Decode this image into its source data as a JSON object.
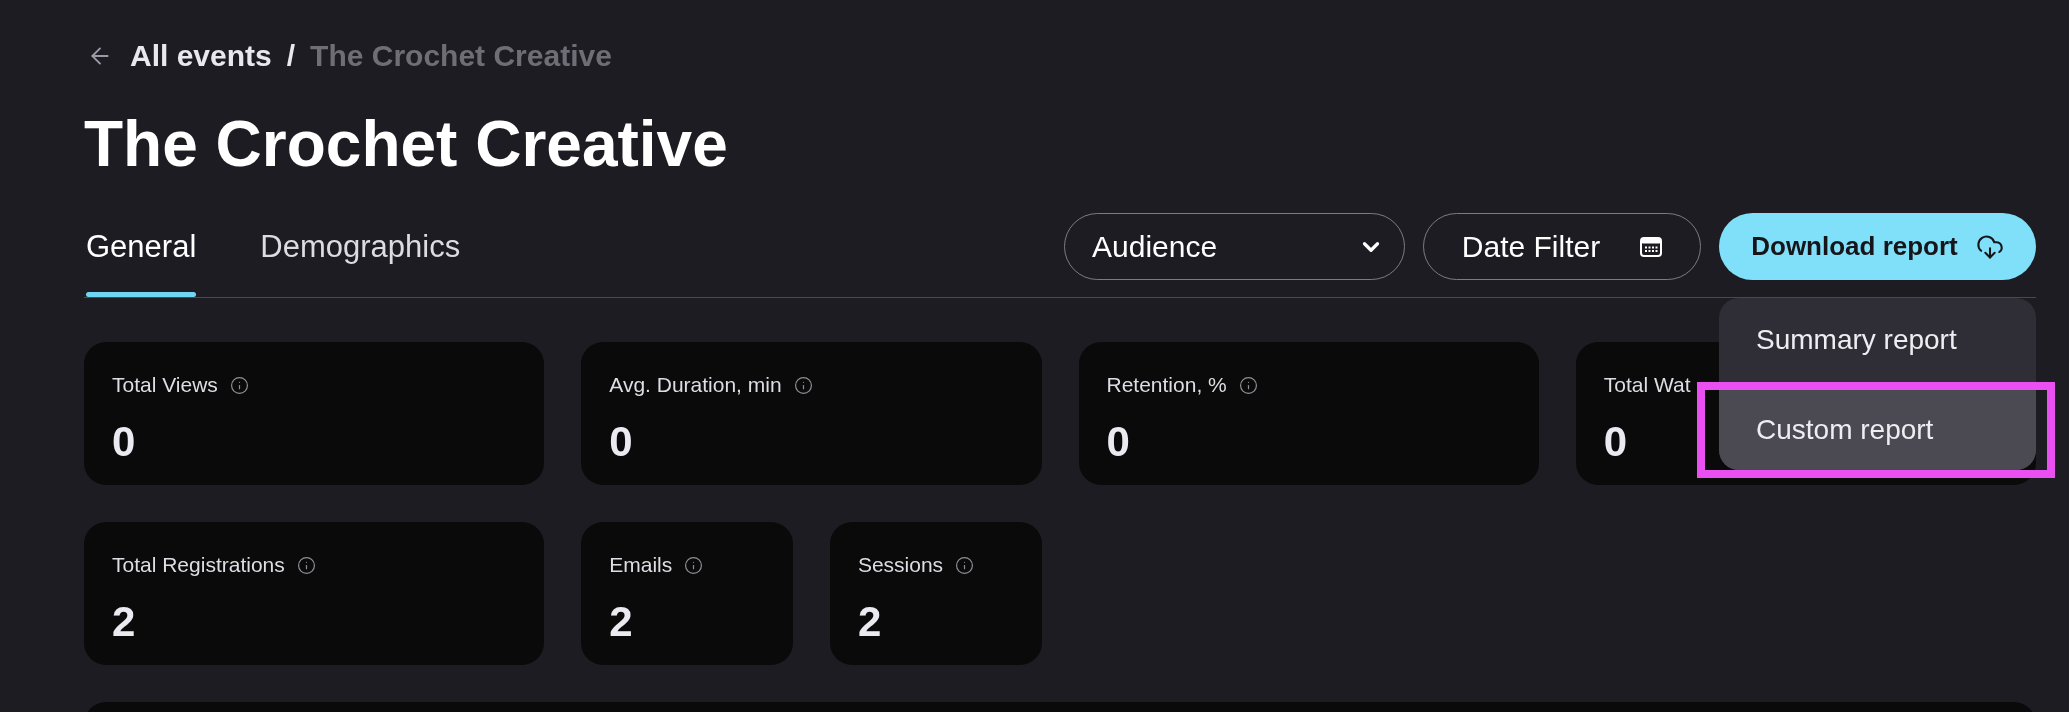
{
  "breadcrumb": {
    "items": [
      {
        "label": "All events",
        "current": false
      },
      {
        "label": "The Crochet Creative",
        "current": true
      }
    ],
    "separator": "/"
  },
  "title": "The Crochet Creative",
  "tabs": [
    {
      "label": "General",
      "selected": true
    },
    {
      "label": "Demographics",
      "selected": false
    }
  ],
  "audience_select": {
    "label": "Audience"
  },
  "date_filter": {
    "label": "Date Filter"
  },
  "download_button": {
    "label": "Download report"
  },
  "download_menu": {
    "items": [
      {
        "label": "Summary report",
        "highlighted": false,
        "annotated": false
      },
      {
        "label": "Custom report",
        "highlighted": true,
        "annotated": true
      }
    ]
  },
  "stats": [
    {
      "kind": "wide",
      "label": "Total Views",
      "value": "0",
      "info": true
    },
    {
      "kind": "wide",
      "label": "Avg. Duration, min",
      "value": "0",
      "info": true
    },
    {
      "kind": "wide",
      "label": "Retention, %",
      "value": "0",
      "info": true
    },
    {
      "kind": "wide",
      "label": "Total Wat",
      "value": "0",
      "info": false
    },
    {
      "kind": "wide",
      "label": "Total Registrations",
      "value": "2",
      "info": true
    },
    {
      "kind": "narrow",
      "label": "Emails",
      "value": "2",
      "info": true
    },
    {
      "kind": "narrow",
      "label": "Sessions",
      "value": "2",
      "info": true
    }
  ]
}
